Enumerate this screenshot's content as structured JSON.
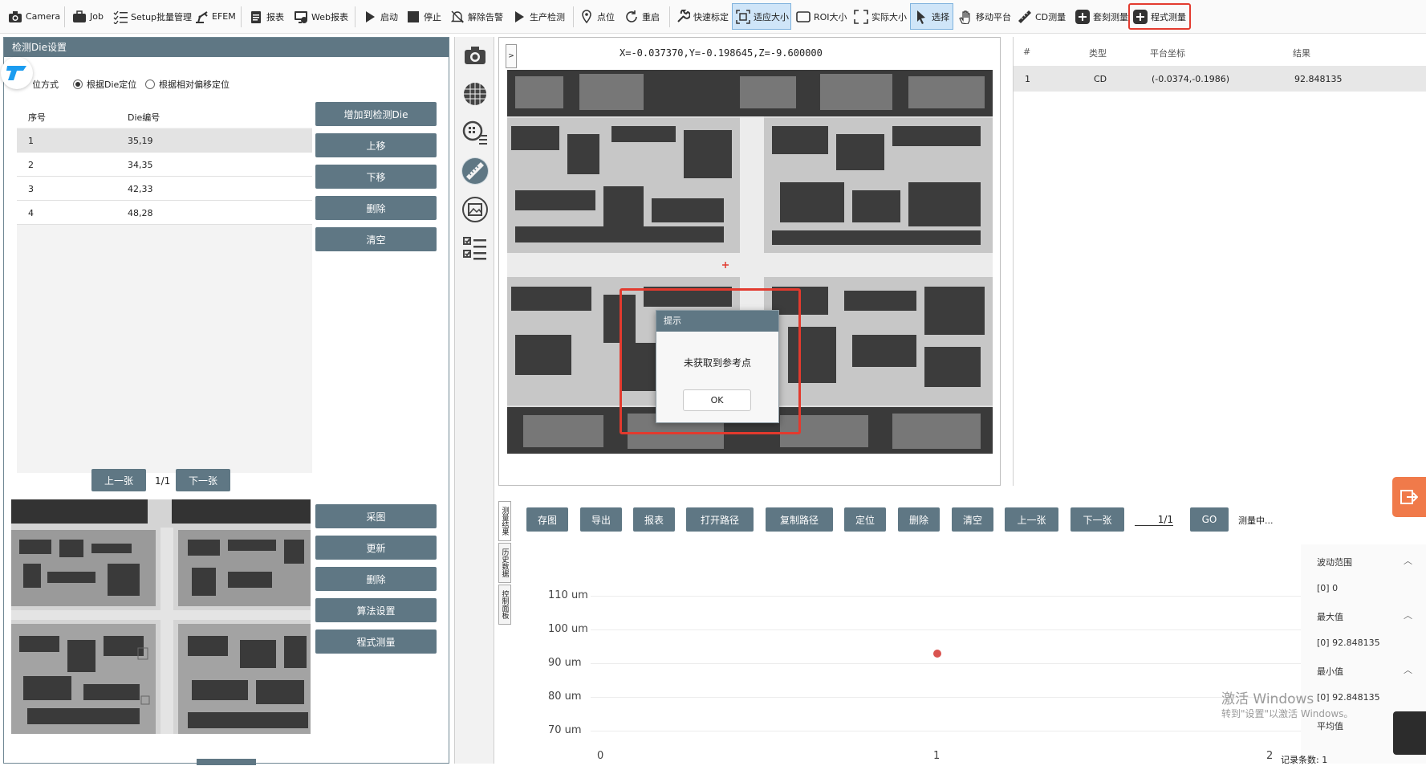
{
  "toolbar": {
    "items": [
      {
        "label": "Camera",
        "icon": "camera-icon"
      },
      {
        "label": "Job",
        "icon": "briefcase-icon"
      },
      {
        "label": "Setup批量管理",
        "icon": "checklist-icon"
      },
      {
        "label": "EFEM",
        "icon": "robot-arm-icon"
      },
      {
        "label": "报表",
        "icon": "clipboard-icon"
      },
      {
        "label": "Web报表",
        "icon": "web-monitor-icon"
      },
      {
        "label": "启动",
        "icon": "play-icon"
      },
      {
        "label": "停止",
        "icon": "stop-icon"
      },
      {
        "label": "解除告警",
        "icon": "bell-off-icon"
      },
      {
        "label": "生产检测",
        "icon": "play-icon"
      },
      {
        "label": "点位",
        "icon": "location-pin-icon"
      },
      {
        "label": "重启",
        "icon": "refresh-icon"
      },
      {
        "label": "快速标定",
        "icon": "wrench-icon"
      },
      {
        "label": "适应大小",
        "icon": "fit-screen-icon"
      },
      {
        "label": "ROI大小",
        "icon": "rectangle-icon"
      },
      {
        "label": "实际大小",
        "icon": "expand-icon"
      },
      {
        "label": "选择",
        "icon": "cursor-icon"
      },
      {
        "label": "移动平台",
        "icon": "hand-icon"
      },
      {
        "label": "CD测量",
        "icon": "ruler-icon"
      },
      {
        "label": "套刻测量",
        "icon": "plus-box-icon"
      },
      {
        "label": "程式测量",
        "icon": "plus-box-icon"
      }
    ]
  },
  "left_panel": {
    "title": "检测Die设置",
    "mode_label": "定位方式",
    "radio_die": "根据Die定位",
    "radio_offset": "根据相对偏移定位",
    "table": {
      "headers": [
        "序号",
        "Die编号"
      ],
      "rows": [
        {
          "index": "1",
          "die": "35,19"
        },
        {
          "index": "2",
          "die": "34,35"
        },
        {
          "index": "3",
          "die": "42,33"
        },
        {
          "index": "4",
          "die": "48,28"
        }
      ]
    },
    "buttons": {
      "add": "增加到检测Die",
      "up": "上移",
      "down": "下移",
      "delete": "删除",
      "clear": "清空"
    },
    "pager": {
      "prev": "上一张",
      "page": "1/1",
      "next": "下一张"
    },
    "image_buttons": {
      "capture": "采图",
      "update": "更新",
      "delete": "删除",
      "algo": "算法设置",
      "recipe": "程式测量"
    }
  },
  "image_view": {
    "expand": ">",
    "coords": "X=-0.037370,Y=-0.198645,Z=-9.600000"
  },
  "dialog": {
    "title": "提示",
    "message": "未获取到参考点",
    "ok": "OK"
  },
  "results": {
    "headers": [
      "#",
      "类型",
      "平台坐标",
      "结果"
    ],
    "rows": [
      {
        "num": "1",
        "type": "CD",
        "coord": "(-0.0374,-0.1986)",
        "result": "92.848135"
      }
    ]
  },
  "bottom": {
    "side_tabs": [
      "测量结果",
      "历史数据",
      "控制面板"
    ],
    "buttons": [
      "存图",
      "导出",
      "报表",
      "打开路径",
      "复制路径",
      "定位",
      "删除",
      "清空",
      "上一张",
      "下一张"
    ],
    "page": "1/1",
    "go": "GO",
    "status": "测量中..."
  },
  "chart_data": {
    "type": "scatter",
    "y_ticks": [
      "110 um",
      "100 um",
      "90 um",
      "80 um",
      "70 um"
    ],
    "x_ticks": [
      "0",
      "1",
      "2"
    ],
    "ylim": [
      70,
      110
    ],
    "xlim": [
      0,
      2
    ],
    "points": [
      {
        "x": 1,
        "y": 92.848135
      }
    ],
    "point_color": "#d9534f"
  },
  "stats": {
    "range_label": "波动范围",
    "range_value": "[0]    0",
    "max_label": "最大值",
    "max_value": "[0]    92.848135",
    "min_label": "最小值",
    "min_value": "[0]    92.848135",
    "avg_label": "平均值"
  },
  "watermark": {
    "line1": "激活 Windows",
    "line2": "转到\"设置\"以激活 Windows。"
  },
  "record_count": "记录条数: 1",
  "colors": {
    "accent": "#5f7784",
    "highlight": "#e23a2e",
    "orange": "#f07a4a"
  }
}
